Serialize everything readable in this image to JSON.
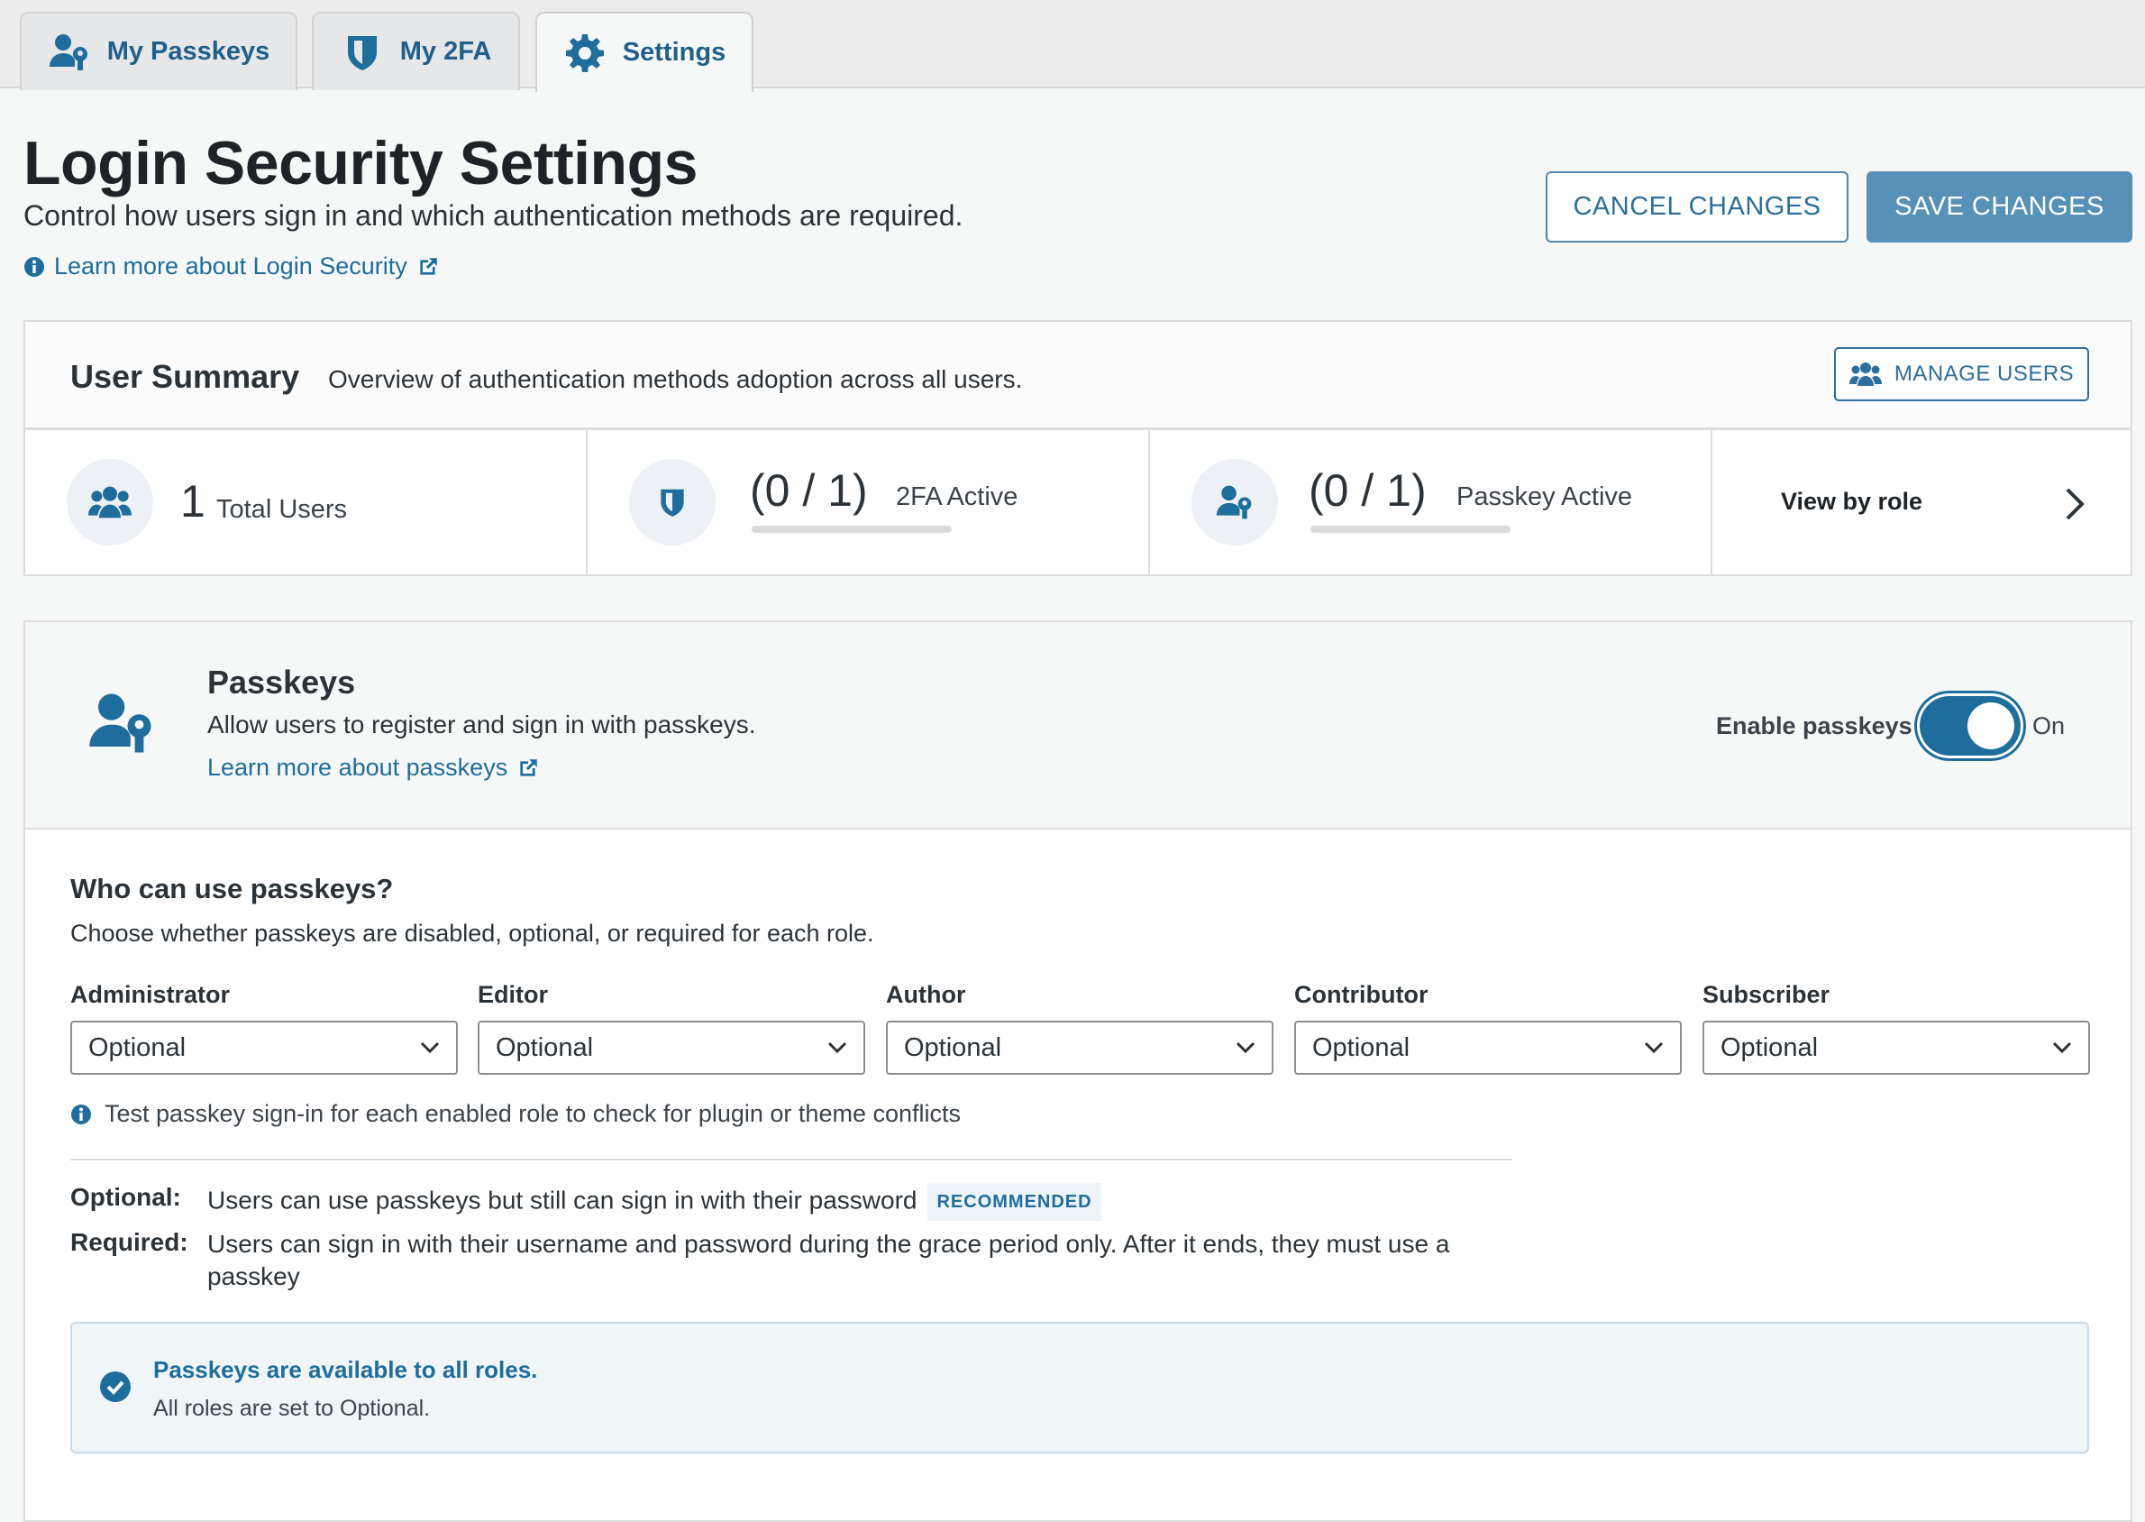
{
  "tabs": [
    {
      "label": "My Passkeys",
      "icon": "user-key-icon"
    },
    {
      "label": "My 2FA",
      "icon": "shield-icon"
    },
    {
      "label": "Settings",
      "icon": "gear-icon",
      "active": true
    }
  ],
  "header": {
    "title": "Login Security Settings",
    "subtitle": "Control how users sign in and which authentication methods are required.",
    "learn_more": "Learn more about Login Security",
    "cancel_label": "CANCEL CHANGES",
    "save_label": "SAVE CHANGES"
  },
  "summary": {
    "title": "User Summary",
    "description": "Overview of authentication methods adoption across all users.",
    "manage_label": "MANAGE USERS",
    "total_users": {
      "value": "1",
      "label": "Total Users"
    },
    "twofa": {
      "value": "(0 / 1)",
      "label": "2FA Active",
      "fraction": 0
    },
    "passkey": {
      "value": "(0 / 1)",
      "label": "Passkey Active",
      "fraction": 0
    },
    "view_by_role": "View by role"
  },
  "passkeys": {
    "title": "Passkeys",
    "description": "Allow users to register and sign in with passkeys.",
    "learn_more": "Learn more about passkeys",
    "toggle_label": "Enable passkeys",
    "toggle_state": "On",
    "who_title": "Who can use passkeys?",
    "who_description": "Choose whether passkeys are disabled, optional, or required for each role.",
    "roles": [
      {
        "label": "Administrator",
        "value": "Optional"
      },
      {
        "label": "Editor",
        "value": "Optional"
      },
      {
        "label": "Author",
        "value": "Optional"
      },
      {
        "label": "Contributor",
        "value": "Optional"
      },
      {
        "label": "Subscriber",
        "value": "Optional"
      }
    ],
    "notice": "Test passkey sign-in for each enabled role to check for plugin or theme conflicts",
    "definitions": {
      "optional_term": "Optional:",
      "optional_text": "Users can use passkeys but still can sign in with their password",
      "optional_badge": "RECOMMENDED",
      "required_term": "Required:",
      "required_text": "Users can sign in with their username and password during the grace period only. After it ends, they must use a passkey"
    },
    "status": {
      "title": "Passkeys are available to all roles.",
      "text": "All roles are set to Optional."
    }
  },
  "colors": {
    "accent": "#1f6d9c",
    "save": "#5891b8",
    "background": "#f6f7f7"
  }
}
